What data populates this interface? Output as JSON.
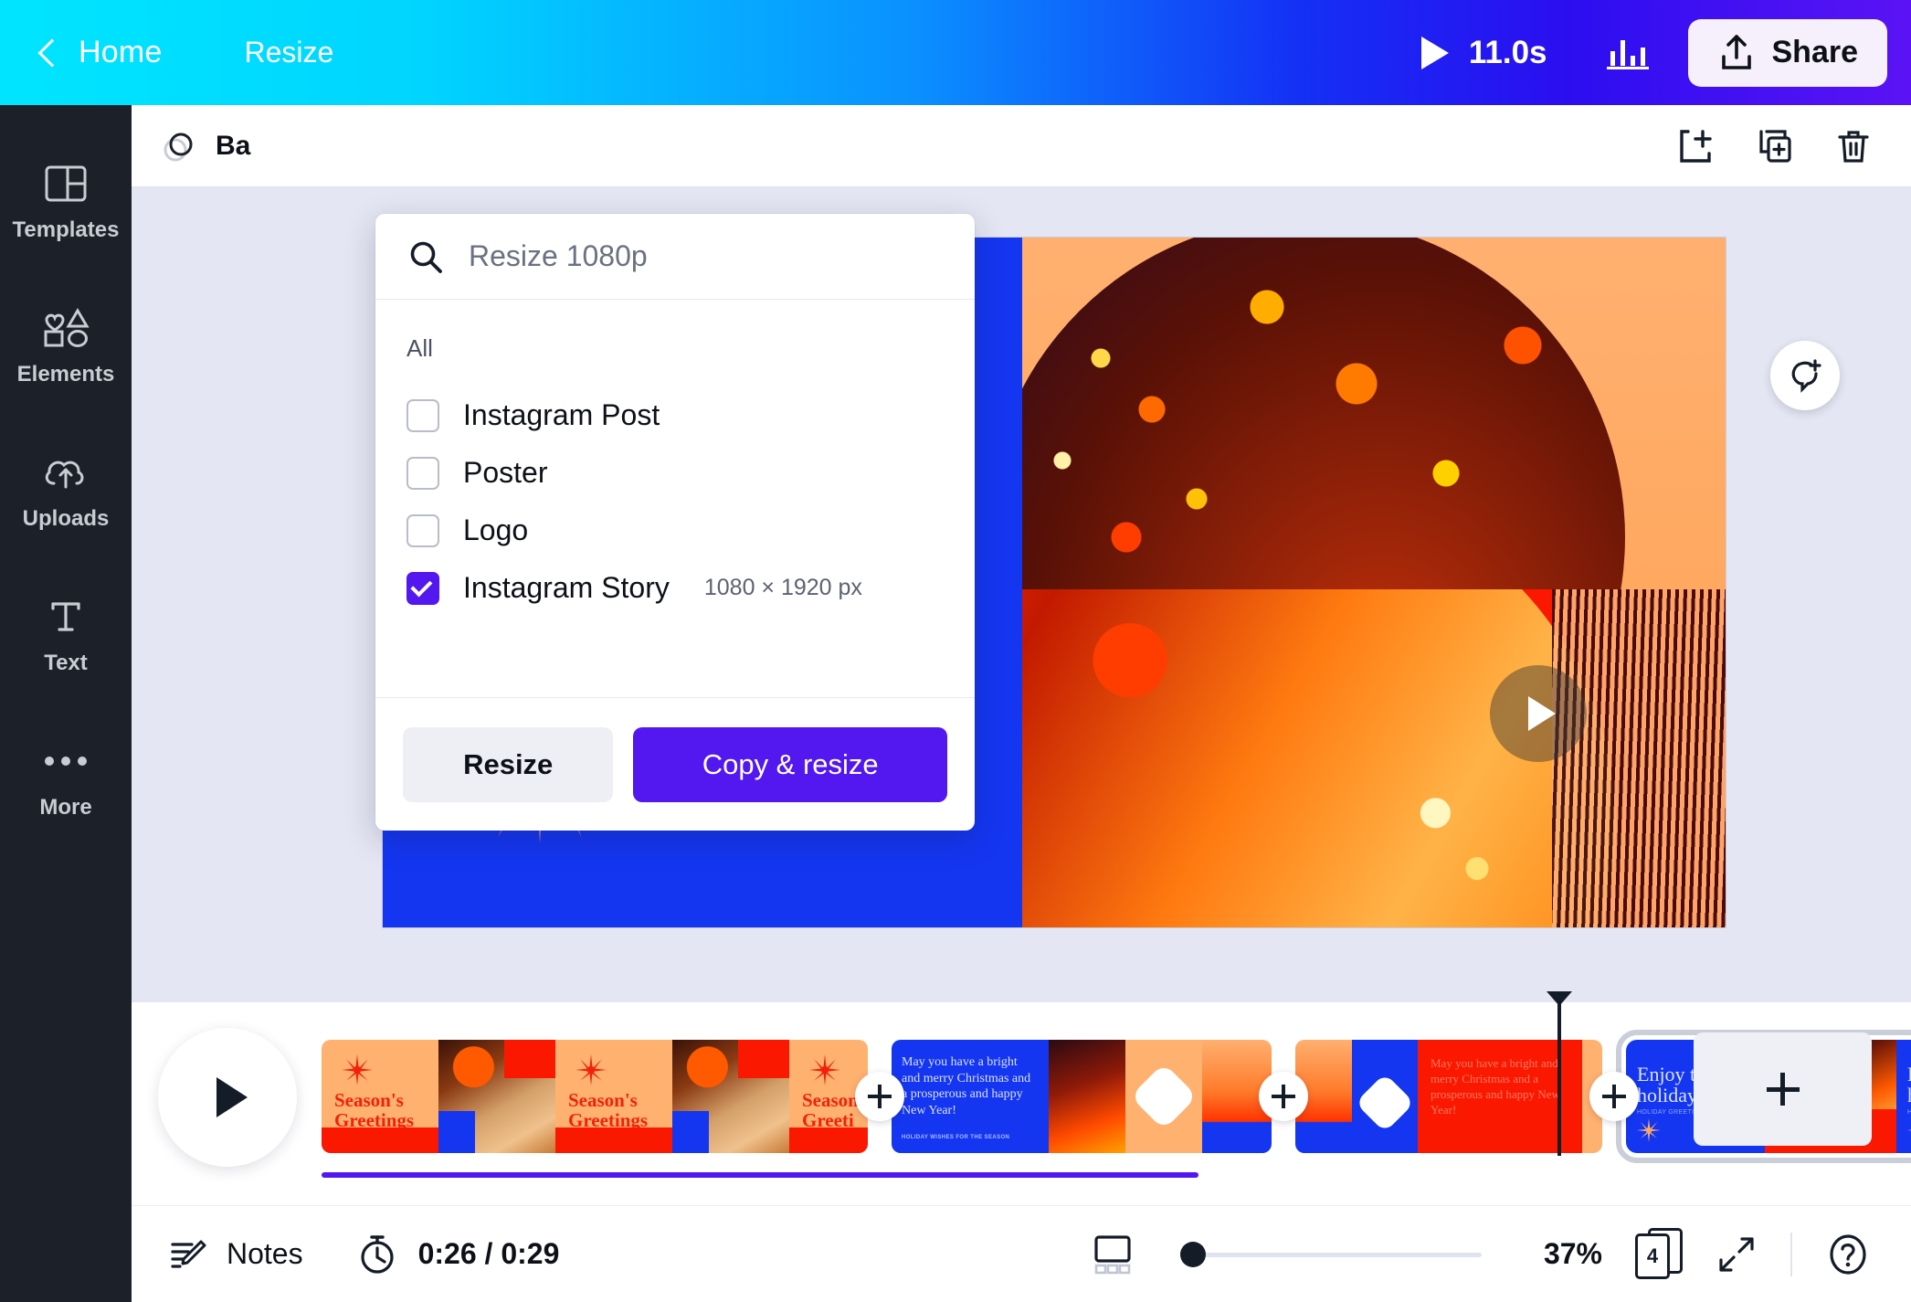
{
  "topbar": {
    "back_icon": "chevron-left-icon",
    "home_label": "Home",
    "resize_label": "Resize",
    "play_icon": "play-icon",
    "duration": "11.0s",
    "analytics_icon": "bar-chart-icon",
    "share_icon": "upload-share-icon",
    "share_label": "Share",
    "gradient_from": "#00e5ff",
    "gradient_to": "#5b13f5"
  },
  "sidebar": {
    "items": [
      {
        "label": "Templates",
        "icon": "templates-grid-icon"
      },
      {
        "label": "Elements",
        "icon": "shapes-icon"
      },
      {
        "label": "Uploads",
        "icon": "cloud-upload-icon"
      },
      {
        "label": "Text",
        "icon": "text-t-icon"
      },
      {
        "label": "More",
        "icon": "ellipsis-icon"
      }
    ]
  },
  "canvas_toolbar": {
    "background_label": "Ba",
    "background_full_label": "Background",
    "background_icon": "color-circles-icon",
    "add_page_icon": "add-page-icon",
    "duplicate_page_icon": "duplicate-page-icon",
    "delete_page_icon": "trash-icon"
  },
  "resize_panel": {
    "search_icon": "search-icon",
    "search_placeholder": "Resize 1080p",
    "search_value": "",
    "group_label": "All",
    "options": [
      {
        "label": "Instagram Post",
        "dimensions": "",
        "checked": false
      },
      {
        "label": "Poster",
        "dimensions": "",
        "checked": false
      },
      {
        "label": "Logo",
        "dimensions": "",
        "checked": false
      },
      {
        "label": "Instagram Story",
        "dimensions": "1080 × 1920 px",
        "checked": true
      }
    ],
    "resize_button": "Resize",
    "copy_resize_button": "Copy & resize",
    "accent_color": "#5317ef"
  },
  "design": {
    "headline": "Enjoy the\nholidays!",
    "headline_line1": "Enjoy the",
    "headline_line2": "holidays!",
    "subtext": "HOLIDAY GREETINGS",
    "starburst_icon": "starburst-icon",
    "play_overlay_icon": "play-icon",
    "comment_icon": "add-comment-icon",
    "bg_blue": "#1436f0",
    "bg_orange": "#ffb170",
    "bg_red": "#fb1800"
  },
  "timeline": {
    "play_icon": "play-icon",
    "add_page_icon": "plus-icon",
    "insert_icon": "plus-icon",
    "clips": [
      {
        "name": "clip-1",
        "selected": false,
        "texts": [
          "Season's Greetings",
          "Season's Greetings",
          "Season's Greeti"
        ]
      },
      {
        "name": "clip-2",
        "selected": false,
        "texts": [
          "May you have a bright and merry Christmas and a prosperous and happy New Year!",
          "HOLIDAY WISHES FOR THE SEASON"
        ]
      },
      {
        "name": "clip-3",
        "selected": false,
        "texts": [
          "May you have a bright and merry Christmas and a prosperous and happy New Year!"
        ]
      },
      {
        "name": "clip-4",
        "selected": true,
        "texts": [
          "Enjoy the holidays!",
          "Enjoy the holidays!"
        ]
      }
    ],
    "progress_percent": 55
  },
  "bottombar": {
    "notes_icon": "notes-pencil-icon",
    "notes_label": "Notes",
    "timer_icon": "stopwatch-icon",
    "time_display": "0:26 / 0:29",
    "layout_icon": "grid-view-icon",
    "zoom_level": "37%",
    "zoom_slider_value": 0,
    "page_count": "4",
    "fullscreen_icon": "expand-arrows-icon",
    "help_icon": "help-circle-icon"
  }
}
